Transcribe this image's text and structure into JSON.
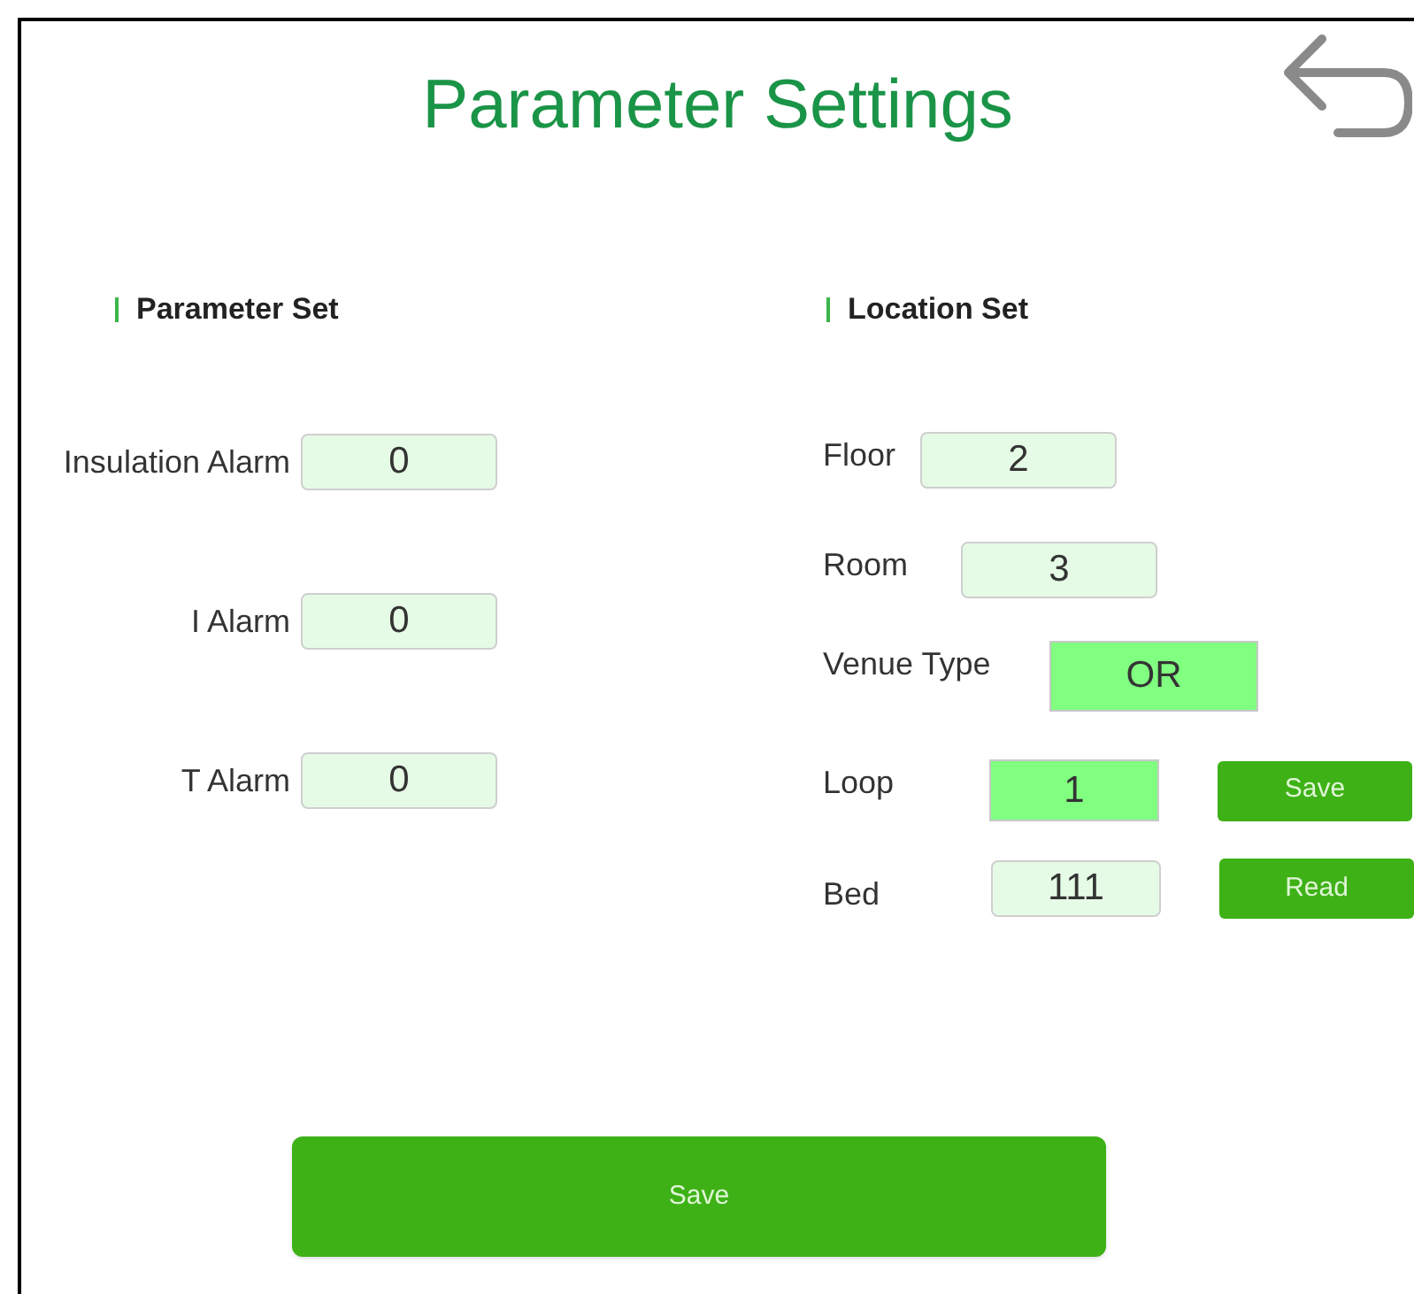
{
  "title": "Parameter Settings",
  "parameter_set": {
    "heading": "Parameter Set",
    "fields": [
      {
        "label": "Insulation Alarm",
        "value": "0",
        "highlighted": false
      },
      {
        "label": "I Alarm",
        "value": "0",
        "highlighted": false
      },
      {
        "label": "T Alarm",
        "value": "0",
        "highlighted": false
      }
    ]
  },
  "location_set": {
    "heading": "Location Set",
    "fields": [
      {
        "label": "Floor",
        "value": "2",
        "highlighted": false
      },
      {
        "label": "Room",
        "value": "3",
        "highlighted": false
      },
      {
        "label": "Venue Type",
        "value": "OR",
        "highlighted": true
      },
      {
        "label": "Loop",
        "value": "1",
        "highlighted": true,
        "button": "Save"
      },
      {
        "label": "Bed",
        "value": "111",
        "highlighted": false,
        "button": "Read"
      }
    ]
  },
  "save_button": "Save"
}
